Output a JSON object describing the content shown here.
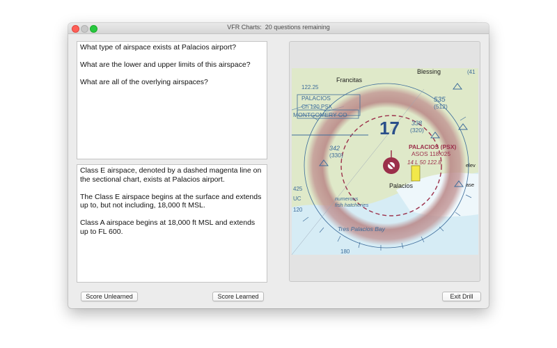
{
  "window": {
    "title": "VFR Charts:  20 questions remaining"
  },
  "question": {
    "paragraphs": [
      "What type of airspace exists at Palacios airport?",
      "What are the lower and upper limits of this airspace?",
      "What are all of the overlying airspaces?"
    ]
  },
  "answer": {
    "paragraphs": [
      "Class E airspace, denoted by a dashed magenta line on the sectional chart, exists at Palacios airport.",
      "The Class E airspace begins at the surface and extends up to, but not including, 18,000 ft MSL.",
      "Class A airspace begins at 18,000 ft MSL and extends up to FL 600."
    ]
  },
  "chart": {
    "labels": {
      "blessing": "Blessing",
      "francitas": "Francitas",
      "freq": "122.25",
      "palacios_vor": "PALACIOS",
      "vor_channel": "Ch 120 PSX",
      "county": "MONTGOMERY CO",
      "alt_535": "535",
      "alt_512": "(512)",
      "alt_338": "338",
      "alt_320": "(320)",
      "alt_342": "342",
      "alt_330": "(330)",
      "maef": "17",
      "airport_name": "PALACIOS (PSX)",
      "airport_info": "ASOS 118.025",
      "airport_data": "14  L 50  122.8",
      "town": "Palacios",
      "hatcheries": "numerous",
      "hatcheries2": "fish hatcheries",
      "bay": "Tres Palacios Bay",
      "edge_41": "(41",
      "edge_425": "425",
      "edge_uc": "UC",
      "edge_120": "120",
      "edge_elev": "elev",
      "edge_ase": "ase",
      "compass_180": "180"
    }
  },
  "buttons": {
    "score_unlearned": "Score Unlearned",
    "score_learned": "Score Learned",
    "exit_drill": "Exit Drill"
  }
}
